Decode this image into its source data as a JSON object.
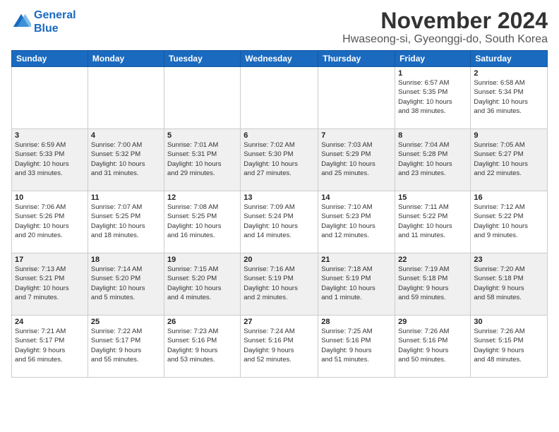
{
  "logo": {
    "line1": "General",
    "line2": "Blue"
  },
  "title": "November 2024",
  "location": "Hwaseong-si, Gyeonggi-do, South Korea",
  "weekdays": [
    "Sunday",
    "Monday",
    "Tuesday",
    "Wednesday",
    "Thursday",
    "Friday",
    "Saturday"
  ],
  "weeks": [
    [
      {
        "day": "",
        "info": ""
      },
      {
        "day": "",
        "info": ""
      },
      {
        "day": "",
        "info": ""
      },
      {
        "day": "",
        "info": ""
      },
      {
        "day": "",
        "info": ""
      },
      {
        "day": "1",
        "info": "Sunrise: 6:57 AM\nSunset: 5:35 PM\nDaylight: 10 hours\nand 38 minutes."
      },
      {
        "day": "2",
        "info": "Sunrise: 6:58 AM\nSunset: 5:34 PM\nDaylight: 10 hours\nand 36 minutes."
      }
    ],
    [
      {
        "day": "3",
        "info": "Sunrise: 6:59 AM\nSunset: 5:33 PM\nDaylight: 10 hours\nand 33 minutes."
      },
      {
        "day": "4",
        "info": "Sunrise: 7:00 AM\nSunset: 5:32 PM\nDaylight: 10 hours\nand 31 minutes."
      },
      {
        "day": "5",
        "info": "Sunrise: 7:01 AM\nSunset: 5:31 PM\nDaylight: 10 hours\nand 29 minutes."
      },
      {
        "day": "6",
        "info": "Sunrise: 7:02 AM\nSunset: 5:30 PM\nDaylight: 10 hours\nand 27 minutes."
      },
      {
        "day": "7",
        "info": "Sunrise: 7:03 AM\nSunset: 5:29 PM\nDaylight: 10 hours\nand 25 minutes."
      },
      {
        "day": "8",
        "info": "Sunrise: 7:04 AM\nSunset: 5:28 PM\nDaylight: 10 hours\nand 23 minutes."
      },
      {
        "day": "9",
        "info": "Sunrise: 7:05 AM\nSunset: 5:27 PM\nDaylight: 10 hours\nand 22 minutes."
      }
    ],
    [
      {
        "day": "10",
        "info": "Sunrise: 7:06 AM\nSunset: 5:26 PM\nDaylight: 10 hours\nand 20 minutes."
      },
      {
        "day": "11",
        "info": "Sunrise: 7:07 AM\nSunset: 5:25 PM\nDaylight: 10 hours\nand 18 minutes."
      },
      {
        "day": "12",
        "info": "Sunrise: 7:08 AM\nSunset: 5:25 PM\nDaylight: 10 hours\nand 16 minutes."
      },
      {
        "day": "13",
        "info": "Sunrise: 7:09 AM\nSunset: 5:24 PM\nDaylight: 10 hours\nand 14 minutes."
      },
      {
        "day": "14",
        "info": "Sunrise: 7:10 AM\nSunset: 5:23 PM\nDaylight: 10 hours\nand 12 minutes."
      },
      {
        "day": "15",
        "info": "Sunrise: 7:11 AM\nSunset: 5:22 PM\nDaylight: 10 hours\nand 11 minutes."
      },
      {
        "day": "16",
        "info": "Sunrise: 7:12 AM\nSunset: 5:22 PM\nDaylight: 10 hours\nand 9 minutes."
      }
    ],
    [
      {
        "day": "17",
        "info": "Sunrise: 7:13 AM\nSunset: 5:21 PM\nDaylight: 10 hours\nand 7 minutes."
      },
      {
        "day": "18",
        "info": "Sunrise: 7:14 AM\nSunset: 5:20 PM\nDaylight: 10 hours\nand 5 minutes."
      },
      {
        "day": "19",
        "info": "Sunrise: 7:15 AM\nSunset: 5:20 PM\nDaylight: 10 hours\nand 4 minutes."
      },
      {
        "day": "20",
        "info": "Sunrise: 7:16 AM\nSunset: 5:19 PM\nDaylight: 10 hours\nand 2 minutes."
      },
      {
        "day": "21",
        "info": "Sunrise: 7:18 AM\nSunset: 5:19 PM\nDaylight: 10 hours\nand 1 minute."
      },
      {
        "day": "22",
        "info": "Sunrise: 7:19 AM\nSunset: 5:18 PM\nDaylight: 9 hours\nand 59 minutes."
      },
      {
        "day": "23",
        "info": "Sunrise: 7:20 AM\nSunset: 5:18 PM\nDaylight: 9 hours\nand 58 minutes."
      }
    ],
    [
      {
        "day": "24",
        "info": "Sunrise: 7:21 AM\nSunset: 5:17 PM\nDaylight: 9 hours\nand 56 minutes."
      },
      {
        "day": "25",
        "info": "Sunrise: 7:22 AM\nSunset: 5:17 PM\nDaylight: 9 hours\nand 55 minutes."
      },
      {
        "day": "26",
        "info": "Sunrise: 7:23 AM\nSunset: 5:16 PM\nDaylight: 9 hours\nand 53 minutes."
      },
      {
        "day": "27",
        "info": "Sunrise: 7:24 AM\nSunset: 5:16 PM\nDaylight: 9 hours\nand 52 minutes."
      },
      {
        "day": "28",
        "info": "Sunrise: 7:25 AM\nSunset: 5:16 PM\nDaylight: 9 hours\nand 51 minutes."
      },
      {
        "day": "29",
        "info": "Sunrise: 7:26 AM\nSunset: 5:16 PM\nDaylight: 9 hours\nand 50 minutes."
      },
      {
        "day": "30",
        "info": "Sunrise: 7:26 AM\nSunset: 5:15 PM\nDaylight: 9 hours\nand 48 minutes."
      }
    ]
  ]
}
